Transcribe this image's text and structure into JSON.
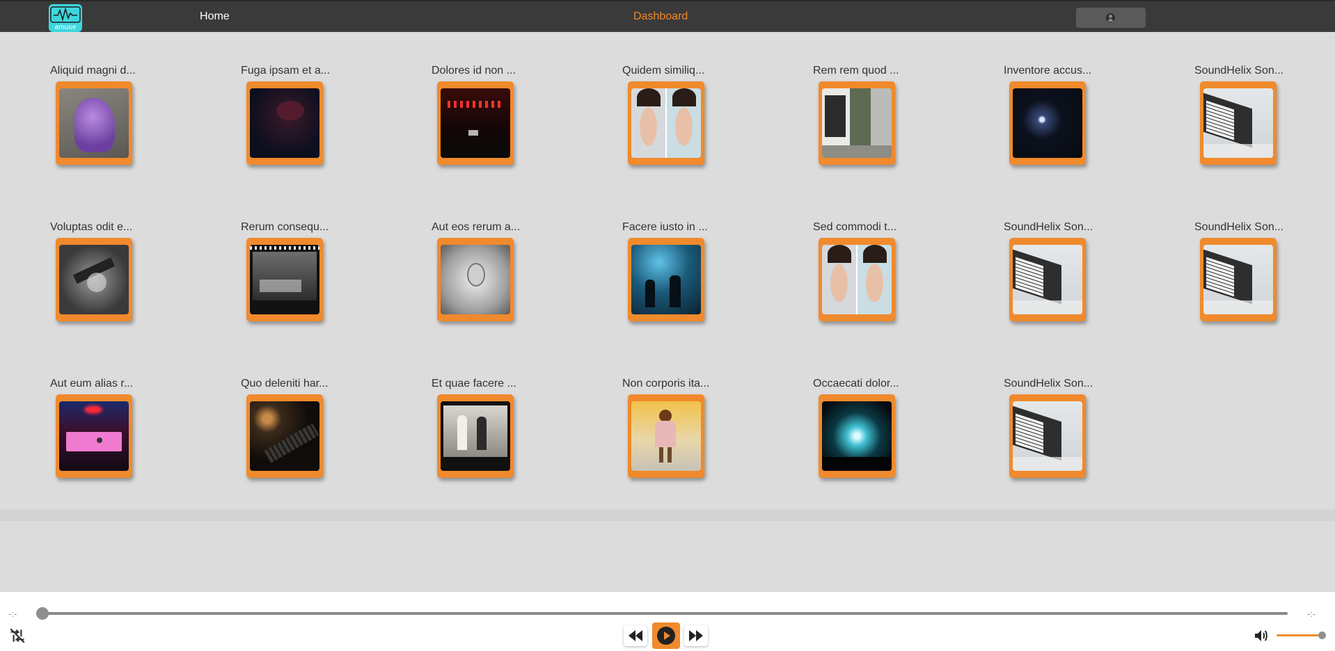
{
  "app": {
    "logo_text": "amuse",
    "brand_color": "#3fd6dd",
    "accent_color": "#f08a2c"
  },
  "nav": {
    "home": "Home",
    "dashboard": "Dashboard",
    "user_icon": "account-circle-icon"
  },
  "songs": [
    {
      "title": "Aliquid magni d...",
      "art": "purple-figure"
    },
    {
      "title": "Fuga ipsam et a...",
      "art": "dark-red-portrait"
    },
    {
      "title": "Dolores id non ...",
      "art": "red-club-ceiling"
    },
    {
      "title": "Quidem similiq...",
      "art": "twin-faces"
    },
    {
      "title": "Rem rem quod ...",
      "art": "street-scene"
    },
    {
      "title": "Inventore accus...",
      "art": "dark-light"
    },
    {
      "title": "SoundHelix Son...",
      "art": "synthesizer"
    },
    {
      "title": "Voluptas odit e...",
      "art": "bw-guitar"
    },
    {
      "title": "Rerum consequ...",
      "art": "bw-film-room"
    },
    {
      "title": "Aut eos rerum a...",
      "art": "bw-singer"
    },
    {
      "title": "Facere iusto in ...",
      "art": "blue-concert"
    },
    {
      "title": "Sed commodi t...",
      "art": "twin-faces"
    },
    {
      "title": "SoundHelix Son...",
      "art": "synthesizer"
    },
    {
      "title": "SoundHelix Son...",
      "art": "synthesizer"
    },
    {
      "title": "Aut eum alias r...",
      "art": "pink-audio-device"
    },
    {
      "title": "Quo deleniti har...",
      "art": "dark-piano"
    },
    {
      "title": "Et quae facere ...",
      "art": "film-people"
    },
    {
      "title": "Non corporis ita...",
      "art": "woman-autumn"
    },
    {
      "title": "Occaecati dolor...",
      "art": "stage-lights"
    },
    {
      "title": "SoundHelix Son...",
      "art": "synthesizer"
    }
  ],
  "player": {
    "current_time": "-:-",
    "duration": "-:-",
    "progress": 0,
    "volume": 1.0,
    "icons": {
      "shuffle": "shuffle-off-icon",
      "previous": "rewind-icon",
      "play": "play-icon",
      "next": "fast-forward-icon",
      "volume": "volume-icon"
    }
  }
}
